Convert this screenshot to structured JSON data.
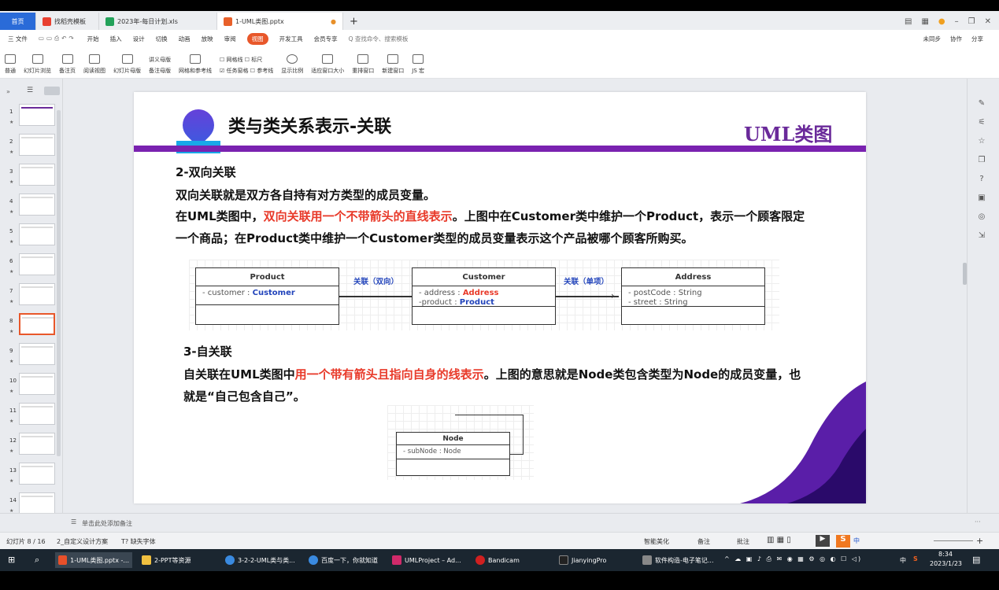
{
  "tabs": [
    {
      "label": "首页",
      "kind": "home"
    },
    {
      "label": "找稻壳模板",
      "kind": "red"
    },
    {
      "label": "2023年-每日计划.xls",
      "kind": "green"
    },
    {
      "label": "1-UML类图.pptx",
      "kind": "orange"
    }
  ],
  "menu": {
    "file": "三 文件",
    "items": [
      "开始",
      "插入",
      "设计",
      "切换",
      "动画",
      "放映",
      "审阅",
      "视图",
      "开发工具",
      "会员专享"
    ],
    "selected": "视图",
    "search": "Q 查找命令、搜索模板",
    "right": [
      "未同步",
      "协作",
      "分享"
    ]
  },
  "ribbon": {
    "buttons": [
      "普通",
      "幻灯片浏览",
      "备注页",
      "阅读视图",
      "幻灯片母版",
      "备注母版",
      "网格和参考线",
      "任务窗格",
      "显示比例",
      "适应窗口大小",
      "重排窗口",
      "新建窗口",
      "JS 宏"
    ],
    "checks": [
      "网格线",
      "标尺",
      "参考线"
    ],
    "extra": "讲义母版"
  },
  "thumbnails": [
    "1",
    "2",
    "3",
    "4",
    "5",
    "6",
    "7",
    "8",
    "9",
    "10",
    "11",
    "12",
    "13",
    "14"
  ],
  "selected_slide": "8",
  "slide": {
    "title": "类与类关系表示-关联",
    "brand": "UML类图",
    "sec2_heading": "2-双向关联",
    "sec2_line1": "双向关联就是双方各自持有对方类型的成员变量。",
    "sec2_line2a": "在UML类图中，",
    "sec2_line2b": "双向关联用一个不带箭头的直线表示",
    "sec2_line2c": "。上图中在Customer类中维护一个Product，表示一个顾客限定",
    "sec2_line3": "一个商品；在Product类中维护一个Customer类型的成员变量表示这个产品被哪个顾客所购买。",
    "sec3_heading": "3-自关联",
    "sec3_line1a": "自关联在UML类图中",
    "sec3_line1b": "用一个带有箭头且指向自身的线表示",
    "sec3_line1c": "。上图的意思就是Node类包含类型为Node的成员变量，也",
    "sec3_line2": "就是“自己包含自己”。",
    "product": {
      "name": "Product",
      "attr_prefix": "- customer : ",
      "attr_type": "Customer"
    },
    "customer": {
      "name": "Customer",
      "attr1_prefix": "- address : ",
      "attr1_type": "Address",
      "attr2_prefix": "-product : ",
      "attr2_type": "Product"
    },
    "address": {
      "name": "Address",
      "attr1": "- postCode : String",
      "attr2": "- street :   String"
    },
    "assoc1": "关联（双向）",
    "assoc2": "关联（单项）",
    "node": {
      "name": "Node",
      "attr": "- subNode : Node"
    }
  },
  "notes_placeholder": "单击此处添加备注",
  "status": {
    "slide_pos": "幻灯片 8 / 16",
    "theme": "2_自定义设计方案",
    "font": "缺失字体",
    "beautify": "智能美化",
    "notes": "备注",
    "comments": "批注"
  },
  "taskbar": [
    "1-UML类图.pptx -...",
    "2-PPT等资源",
    "3-2-2-UML类与类...",
    "百度一下，你就知道",
    "UMLProject – Ad...",
    "Bandicam",
    "JianyingPro",
    "软件构造-电子笔记..."
  ],
  "clock": {
    "time": "8:34",
    "date": "2023/1/23"
  },
  "tray_lang": "中"
}
